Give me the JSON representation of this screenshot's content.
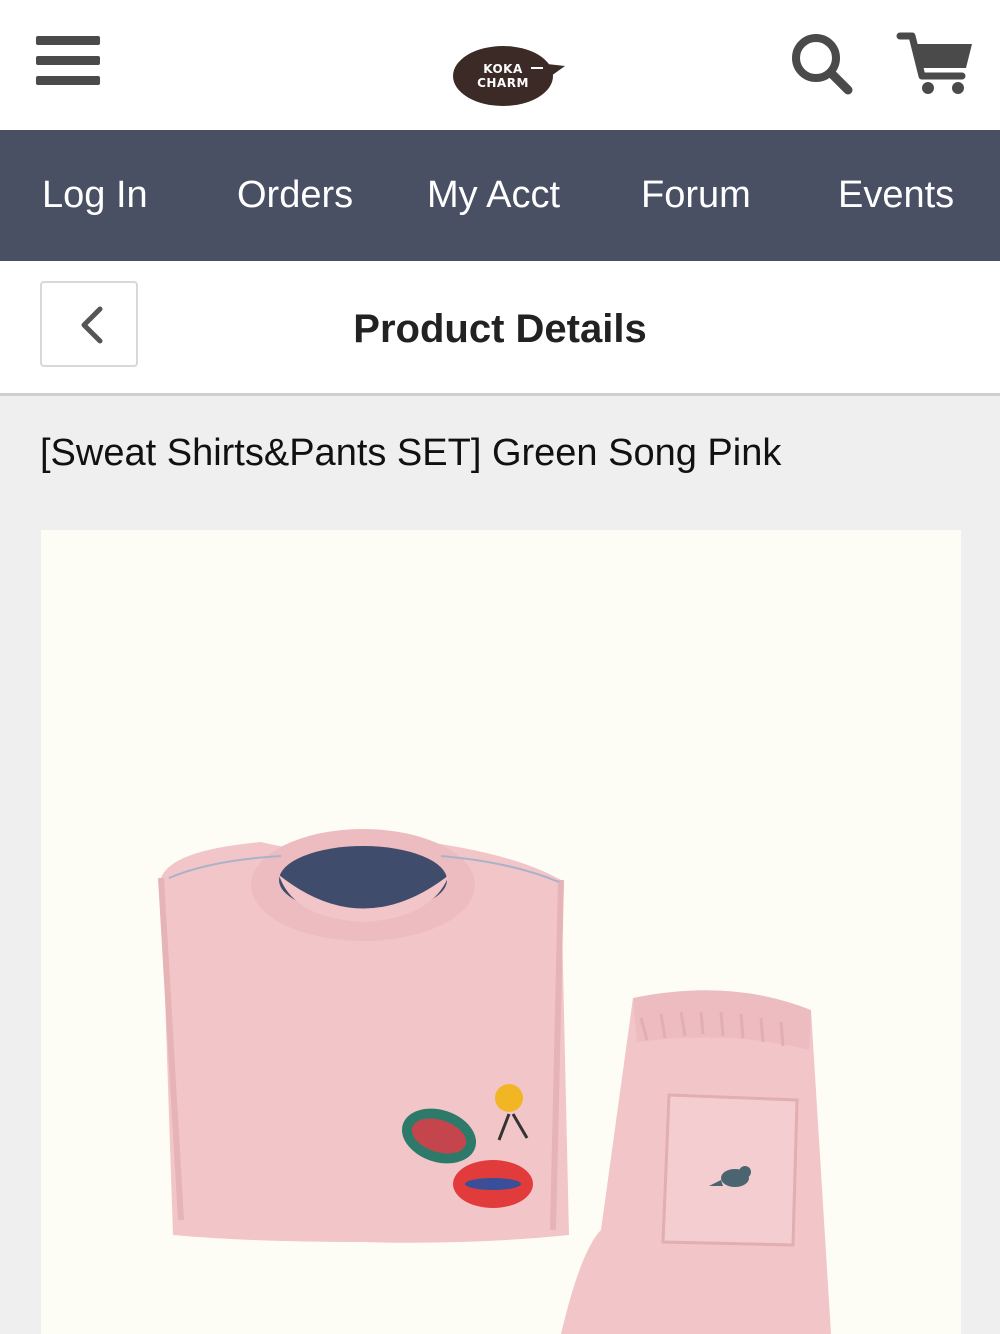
{
  "header": {
    "logo_line1": "KOKA",
    "logo_line2": "CHARM",
    "icons": {
      "menu": "hamburger-menu-icon",
      "search": "search-icon",
      "cart": "cart-icon"
    }
  },
  "nav": {
    "items": [
      {
        "label": "Log In"
      },
      {
        "label": "Orders"
      },
      {
        "label": "My Acct"
      },
      {
        "label": "Forum"
      },
      {
        "label": "Events"
      }
    ],
    "background": "#4a5064"
  },
  "subheader": {
    "back_icon": "chevron-left-icon",
    "title": "Product Details"
  },
  "product": {
    "title": "[Sweat Shirts&Pants SET] Green Song Pink",
    "image_subject": "pink-sweatshirt-and-pants-set",
    "colors": {
      "garment": "#f2c5c8",
      "image_background": "#fdfdf6"
    }
  }
}
